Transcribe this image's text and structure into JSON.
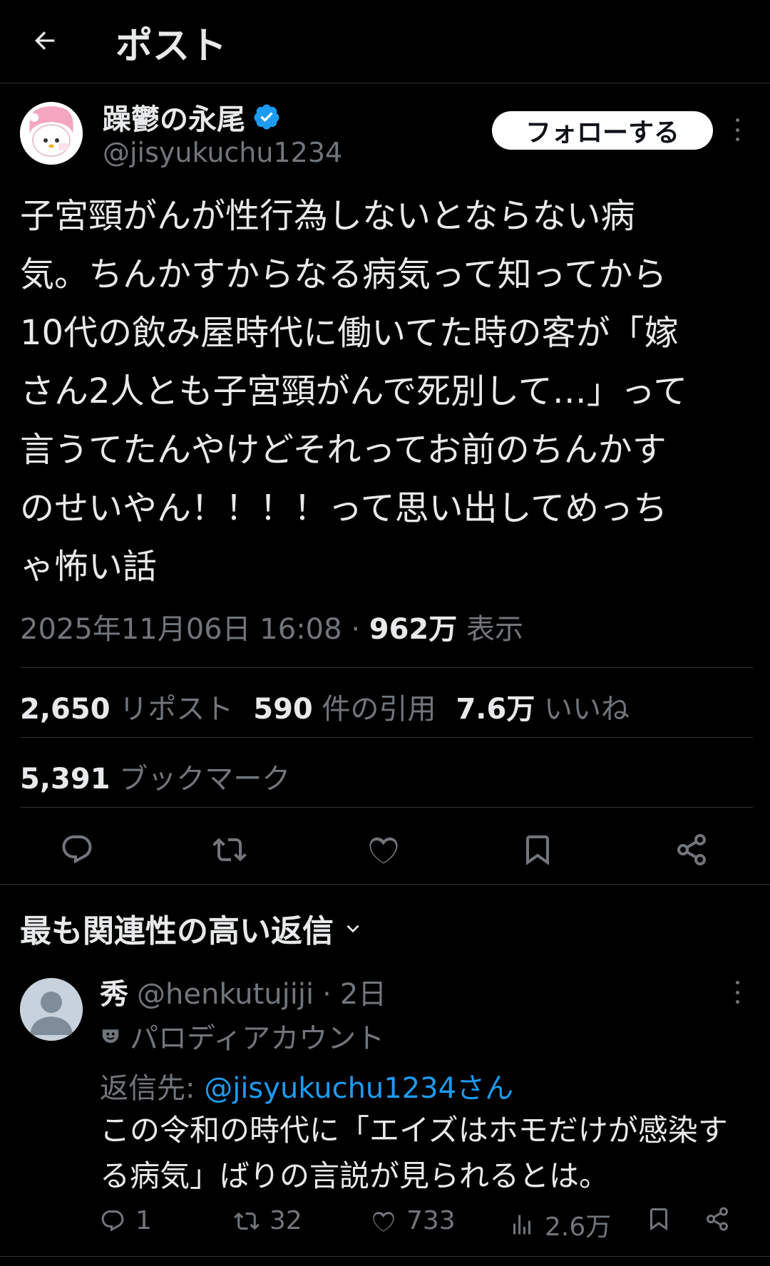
{
  "header": {
    "title": "ポスト"
  },
  "post": {
    "display_name": "躁鬱の永尾",
    "handle": "@jisyukuchu1234",
    "follow_label": "フォローする",
    "text": "子宮頸がんが性行為しないとならない病\n気。ちんかすからなる病気って知ってから\n10代の飲み屋時代に働いてた時の客が「嫁\nさん2人とも子宮頸がんで死別して…」って\n言うてたんやけどそれってお前のちんかす\nのせいやん！！！！って思い出してめっち\nゃ怖い話",
    "timestamp": "2025年11月06日 16:08",
    "separator": "·",
    "views_count": "962万",
    "views_label": "表示",
    "reposts_count": "2,650",
    "reposts_label": "リポスト",
    "quotes_count": "590",
    "quotes_label": "件の引用",
    "likes_count": "7.6万",
    "likes_label": "いいね",
    "bookmarks_count": "5,391",
    "bookmarks_label": "ブックマーク"
  },
  "replies_section": {
    "sort_label": "最も関連性の高い返信"
  },
  "reply": {
    "name": "秀",
    "handle": "@henkutujiji",
    "separator": "·",
    "time": "2日",
    "parody_label": "パロディアカウント",
    "replying_to_label": "返信先: ",
    "replying_to_mention": "@jisyukuchu1234さん",
    "text": "この令和の時代に「エイズはホモだけが感染する病気」ばりの言説が見られるとは。",
    "reply_count": "1",
    "repost_count": "32",
    "like_count": "733",
    "view_count": "2.6万"
  },
  "colors": {
    "accent": "#1d9bf0",
    "muted": "#71767b",
    "text": "#e7e9ea",
    "background": "#000000"
  }
}
